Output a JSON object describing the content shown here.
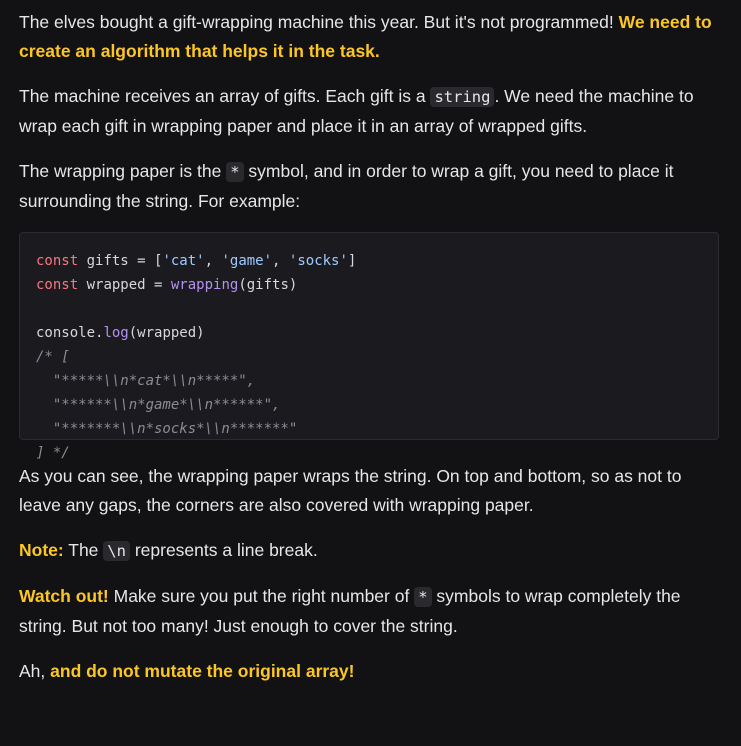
{
  "intro": {
    "text": "The elves bought a gift-wrapping machine this year. But it's not programmed! ",
    "highlight": "We need to create an algorithm that helps it in the task."
  },
  "para2": {
    "before": "The machine receives an array of gifts. Each gift is a ",
    "code": "string",
    "after": ". We need the machine to wrap each gift in wrapping paper and place it in an array of wrapped gifts."
  },
  "para3": {
    "before": "The wrapping paper is the ",
    "code": "*",
    "after": " symbol, and in order to wrap a gift, you need to place it surrounding the string. For example:"
  },
  "code_example": {
    "line1": {
      "kw": "const",
      "var": " gifts = [",
      "s1": "'cat'",
      "c1": ", ",
      "s2": "'game'",
      "c2": ", ",
      "s3": "'socks'",
      "end": "]"
    },
    "line2": {
      "kw": "const",
      "var": " wrapped = ",
      "fn": "wrapping",
      "end": "(gifts)"
    },
    "line4": {
      "obj": "console.",
      "fn": "log",
      "end": "(wrapped)"
    },
    "line5": "/* [",
    "line6": "  \"*****\\\\n*cat*\\\\n*****\",",
    "line7": "  \"******\\\\n*game*\\\\n******\",",
    "line8": "  \"*******\\\\n*socks*\\\\n*******\"",
    "line9": "] */"
  },
  "para4": {
    "text": "As you can see, the wrapping paper wraps the string. On top and bottom, so as not to leave any gaps, the corners are also covered with wrapping paper."
  },
  "note": {
    "label": "Note:",
    "before": " The ",
    "code": "\\n",
    "after": " represents a line break."
  },
  "watch": {
    "label": "Watch out!",
    "before": " Make sure you put the right number of ",
    "code": "*",
    "after": " symbols to wrap completely the string. But not too many! Just enough to cover the string."
  },
  "final": {
    "before": "Ah, ",
    "highlight": "and do not mutate the original array!"
  }
}
